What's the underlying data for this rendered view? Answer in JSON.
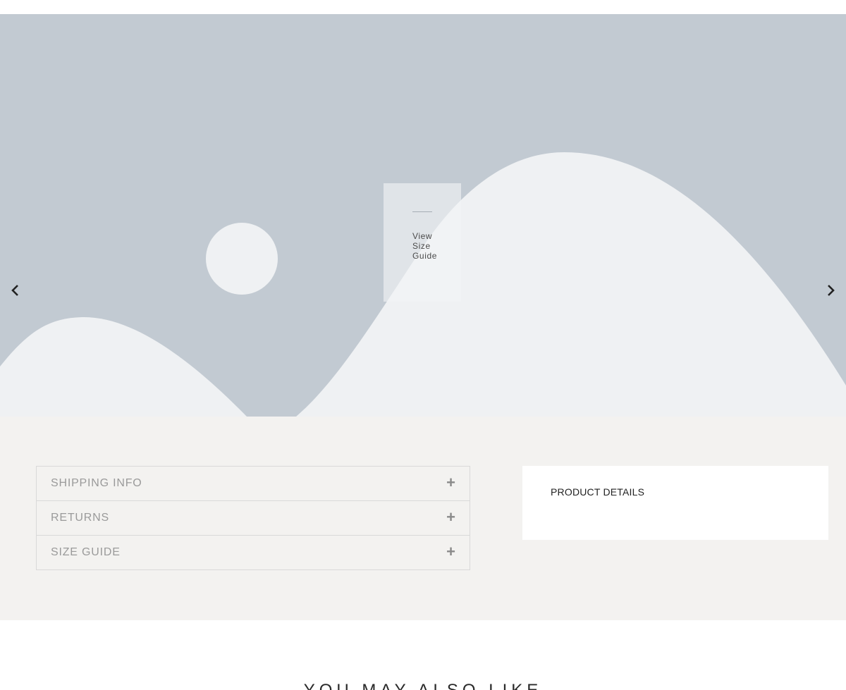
{
  "hero": {
    "prev_icon": "chevron-left-icon",
    "next_icon": "chevron-right-icon",
    "size_guide_link": "View Size Guide"
  },
  "accordion": {
    "items": [
      {
        "label": "SHIPPING INFO",
        "icon": "plus-icon"
      },
      {
        "label": "RETURNS",
        "icon": "plus-icon"
      },
      {
        "label": "SIZE GUIDE",
        "icon": "plus-icon"
      }
    ]
  },
  "details": {
    "title": "PRODUCT DETAILS"
  },
  "related": {
    "title": "YOU MAY ALSO LIKE"
  },
  "colors": {
    "hero_bg": "#c2cad2",
    "placeholder_shape": "#eff1f3",
    "band_bg": "#f3f2f0"
  }
}
